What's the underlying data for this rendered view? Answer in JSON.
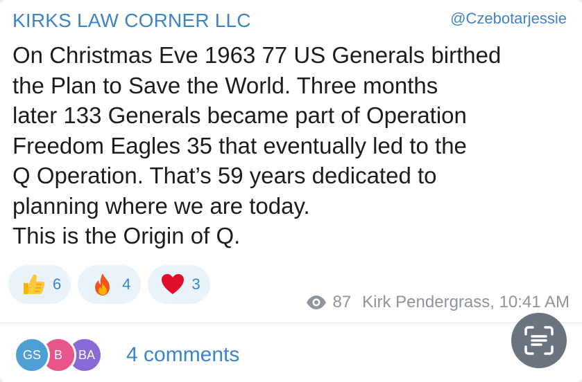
{
  "header": {
    "channel_name": "KIRKS LAW CORNER LLC",
    "handle": "@Czebotarjessie"
  },
  "message": {
    "text": "On Christmas Eve 1963 77 US Generals birthed\nthe Plan to Save the World. Three months\nlater 133 Generals became part of Operation\nFreedom Eagles 35 that eventually led to the\nQ Operation. That’s 59 years dedicated to\nplanning where we are today.\nThis is the Origin of Q."
  },
  "reactions": [
    {
      "icon": "thumbs-up-icon",
      "count": "6"
    },
    {
      "icon": "fire-icon",
      "count": "4"
    },
    {
      "icon": "heart-icon",
      "count": "3"
    }
  ],
  "meta": {
    "views": "87",
    "author_time": "Kirk Pendergrass, 10:41 AM"
  },
  "comments": {
    "avatars": [
      "GS",
      "B",
      "BA"
    ],
    "label": "4 comments"
  },
  "colors": {
    "accent": "#3d84c5",
    "reaction_bg": "#eaf2fa",
    "meta": "#8d959c",
    "comment_button": "#6b7380"
  }
}
